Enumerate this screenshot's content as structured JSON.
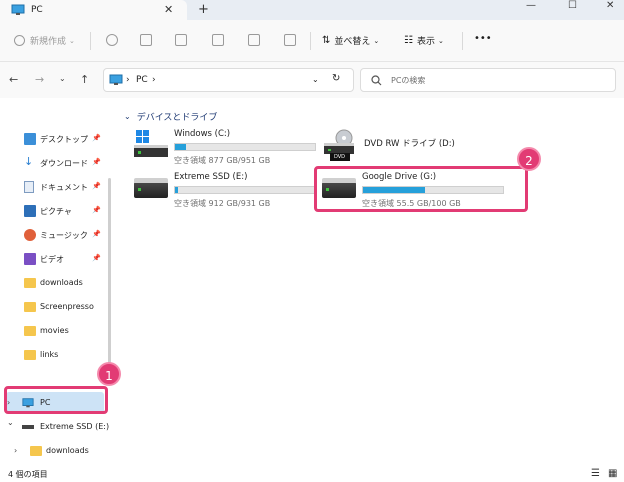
{
  "tab": {
    "title": "PC",
    "close": "✕",
    "new": "+"
  },
  "window_controls": [
    "—",
    "☐",
    "✕"
  ],
  "toolbar": {
    "new": "新規作成",
    "sort": "並べ替え",
    "view": "表示",
    "more": "•••"
  },
  "address": {
    "crumb1": "PC",
    "sep": "›",
    "sep2": "›",
    "search_placeholder": "PCの検索"
  },
  "sidebar": {
    "pin": "📌",
    "quick": [
      {
        "label": "デスクトップ",
        "icon": "desktop-icon",
        "pinned": true
      },
      {
        "label": "ダウンロード",
        "icon": "download-icon",
        "pinned": true
      },
      {
        "label": "ドキュメント",
        "icon": "document-icon",
        "pinned": true
      },
      {
        "label": "ピクチャ",
        "icon": "picture-icon",
        "pinned": true
      },
      {
        "label": "ミュージック",
        "icon": "music-icon",
        "pinned": true
      },
      {
        "label": "ビデオ",
        "icon": "video-icon",
        "pinned": true
      },
      {
        "label": "downloads",
        "icon": "folder-icon"
      },
      {
        "label": "Screenpresso",
        "icon": "folder-icon"
      },
      {
        "label": "movies",
        "icon": "folder-icon"
      },
      {
        "label": "links",
        "icon": "folder-icon"
      }
    ],
    "pc": "PC",
    "extreme": "Extreme SSD (E:)",
    "downloads": "downloads",
    "chevron_right": "›",
    "chevron_down": "⌄"
  },
  "content": {
    "section": "デバイスとドライブ",
    "drives": [
      {
        "name": "Windows (C:)",
        "free": "空き領域 877 GB/951 GB",
        "used": 0.08
      },
      {
        "name": "DVD RW ドライブ (D:)",
        "free": "",
        "used": null
      },
      {
        "name": "Extreme SSD (E:)",
        "free": "空き領域 912 GB/931 GB",
        "used": 0.02
      },
      {
        "name": "Google Drive (G:)",
        "free": "空き領域 55.5 GB/100 GB",
        "used": 0.445
      }
    ],
    "dvd_label": "DVD"
  },
  "annotations": {
    "one": "1",
    "two": "2"
  },
  "status": {
    "count": "4 個の項目"
  },
  "colors": {
    "accent": "#26a0da",
    "highlight": "#e23b74",
    "selected": "#cde3f6"
  }
}
